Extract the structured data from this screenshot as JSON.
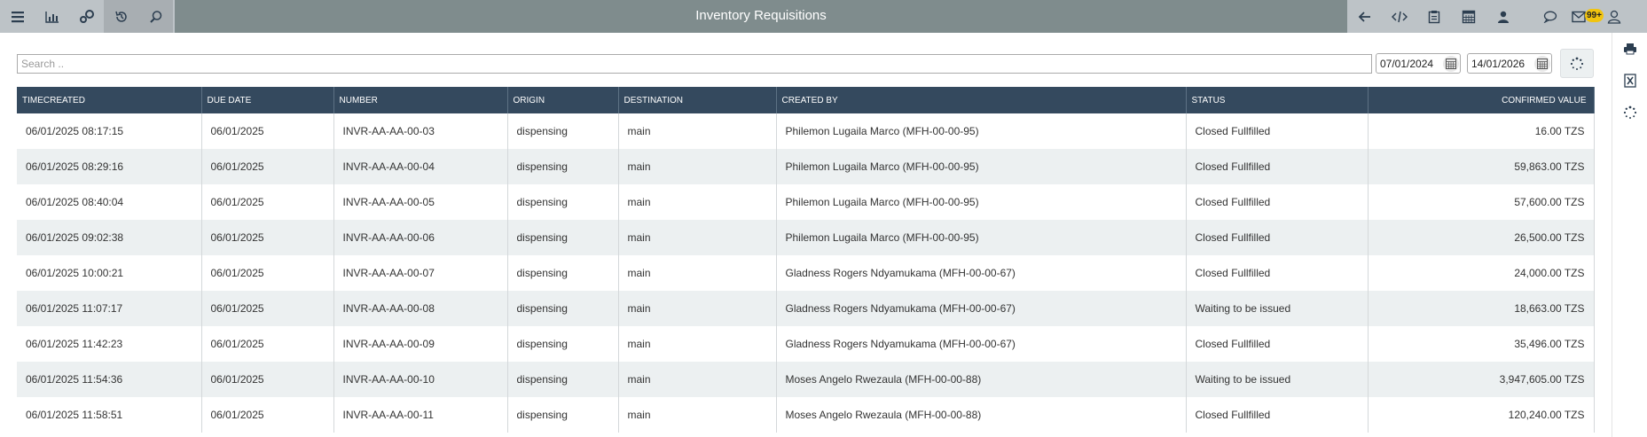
{
  "header": {
    "title": "Inventory Requisitions",
    "left_icons": [
      "menu-icon",
      "bar-chart-icon",
      "settings-icon",
      "history-icon",
      "search-icon"
    ],
    "right_icons": [
      "back-arrow-icon",
      "code-icon",
      "clipboard-icon",
      "calculator-icon",
      "user-switch-icon",
      "chat-icon",
      "mail-icon",
      "user-icon"
    ],
    "mail_badge": "99+"
  },
  "side_rail": {
    "icons": [
      "print-icon",
      "excel-icon",
      "refresh-icon"
    ]
  },
  "filters": {
    "search_placeholder": "Search ..",
    "date_from": "07/01/2024",
    "date_to": "14/01/2026"
  },
  "table": {
    "columns": [
      "TIMECREATED",
      "DUE DATE",
      "NUMBER",
      "ORIGIN",
      "DESTINATION",
      "CREATED BY",
      "STATUS",
      "CONFIRMED VALUE"
    ],
    "rows": [
      [
        "06/01/2025 08:17:15",
        "06/01/2025",
        "INVR-AA-AA-00-03",
        "dispensing",
        "main",
        "Philemon Lugaila Marco (MFH-00-00-95)",
        "Closed Fullfilled",
        "16.00 TZS"
      ],
      [
        "06/01/2025 08:29:16",
        "06/01/2025",
        "INVR-AA-AA-00-04",
        "dispensing",
        "main",
        "Philemon Lugaila Marco (MFH-00-00-95)",
        "Closed Fullfilled",
        "59,863.00 TZS"
      ],
      [
        "06/01/2025 08:40:04",
        "06/01/2025",
        "INVR-AA-AA-00-05",
        "dispensing",
        "main",
        "Philemon Lugaila Marco (MFH-00-00-95)",
        "Closed Fullfilled",
        "57,600.00 TZS"
      ],
      [
        "06/01/2025 09:02:38",
        "06/01/2025",
        "INVR-AA-AA-00-06",
        "dispensing",
        "main",
        "Philemon Lugaila Marco (MFH-00-00-95)",
        "Closed Fullfilled",
        "26,500.00 TZS"
      ],
      [
        "06/01/2025 10:00:21",
        "06/01/2025",
        "INVR-AA-AA-00-07",
        "dispensing",
        "main",
        "Gladness Rogers Ndyamukama (MFH-00-00-67)",
        "Closed Fullfilled",
        "24,000.00 TZS"
      ],
      [
        "06/01/2025 11:07:17",
        "06/01/2025",
        "INVR-AA-AA-00-08",
        "dispensing",
        "main",
        "Gladness Rogers Ndyamukama (MFH-00-00-67)",
        "Waiting to be issued",
        "18,663.00 TZS"
      ],
      [
        "06/01/2025 11:42:23",
        "06/01/2025",
        "INVR-AA-AA-00-09",
        "dispensing",
        "main",
        "Gladness Rogers Ndyamukama (MFH-00-00-67)",
        "Closed Fullfilled",
        "35,496.00 TZS"
      ],
      [
        "06/01/2025 11:54:36",
        "06/01/2025",
        "INVR-AA-AA-00-10",
        "dispensing",
        "main",
        "Moses Angelo Rwezaula (MFH-00-00-88)",
        "Waiting to be issued",
        "3,947,605.00 TZS"
      ],
      [
        "06/01/2025 11:58:51",
        "06/01/2025",
        "INVR-AA-AA-00-11",
        "dispensing",
        "main",
        "Moses Angelo Rwezaula (MFH-00-00-88)",
        "Closed Fullfilled",
        "120,240.00 TZS"
      ]
    ]
  },
  "colors": {
    "topbar": "#7f8c8d",
    "toolbar_group": "#bdc3c7",
    "table_header": "#34495e",
    "row_alt": "#ecf0f1",
    "badge": "#f1c40f"
  }
}
